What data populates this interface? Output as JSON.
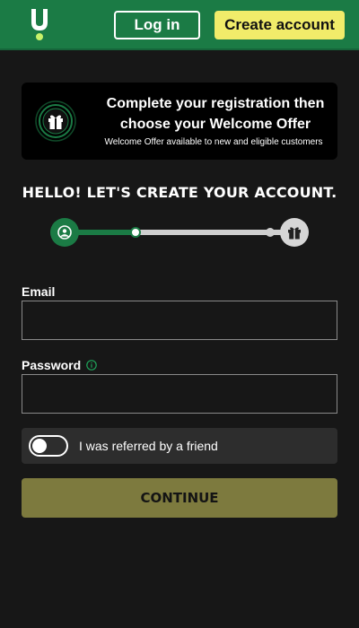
{
  "header": {
    "login_label": "Log in",
    "create_account_label": "Create account",
    "logo_icon": "unibet-u-logo"
  },
  "offer": {
    "title_line1": "Complete your registration then",
    "title_line2": "choose your Welcome Offer",
    "subtitle": "Welcome Offer available to new and eligible customers",
    "icon": "gift-icon"
  },
  "heading": "HELLO! LET'S CREATE YOUR ACCOUNT.",
  "progress": {
    "start_icon": "user-icon",
    "end_icon": "gift-icon",
    "fraction": 0.3
  },
  "form": {
    "email_label": "Email",
    "email_value": "",
    "password_label": "Password",
    "password_value": "",
    "password_info_icon": "info-icon",
    "referral_label": "I was referred by a friend",
    "referral_on": false,
    "continue_label": "CONTINUE"
  },
  "colors": {
    "brand_green": "#1b7b45",
    "create_button": "#f1ec6a",
    "continue_button": "#7d7a3e",
    "background": "#171717"
  }
}
